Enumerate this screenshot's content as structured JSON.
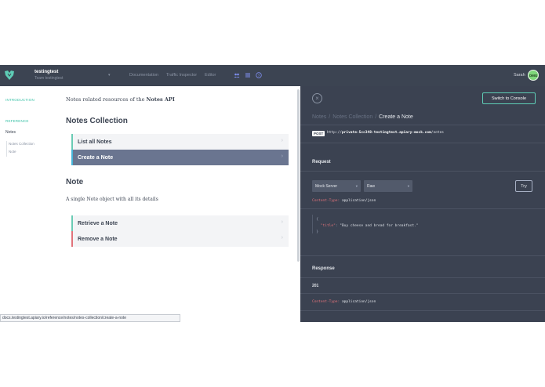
{
  "header": {
    "project_name": "testingtest",
    "project_owner": "Team testingtest",
    "nav": [
      "Documentation",
      "Traffic Inspector",
      "Editor"
    ],
    "user": "Sarah",
    "avatar_initials": "OMG"
  },
  "sidebar": {
    "introduction": "INTRODUCTION",
    "reference": "REFERENCE",
    "group": "Notes",
    "items": [
      "Notes Collection",
      "Note"
    ]
  },
  "main": {
    "intro_prefix": "Notes related resources of the ",
    "intro_api": "Notes API",
    "collection_title": "Notes Collection",
    "collection_actions": [
      "List all Notes",
      "Create a Note"
    ],
    "note_title": "Note",
    "note_desc": "A single Note object with all its details",
    "note_actions": [
      "Retrieve a Note",
      "Remove a Note"
    ],
    "chevron": "›"
  },
  "console": {
    "close": "×",
    "switch_label": "Switch to Console",
    "breadcrumbs": [
      "Notes",
      "Notes Collection",
      "Create a Note"
    ],
    "breadcrumb_sep": "/",
    "method": "POST",
    "url_prefix": "http://",
    "url_host": "private-5cc348-testingtest.apiary-mock.com",
    "url_path": "/notes",
    "request_title": "Request",
    "server_select": "Mock Server",
    "format_select": "Raw",
    "try_label": "Try",
    "request_header_key": "Content-Type:",
    "request_header_value": " application/json",
    "body_open": "{",
    "body_key": "\"title\"",
    "body_colon": ": ",
    "body_value": "\"Buy cheese and bread for breakfast.\"",
    "body_close": "}",
    "response_title": "Response",
    "status_code": "201",
    "response_header_key": "Content-Type:",
    "response_header_value": " application/json"
  },
  "statusbar": {
    "url": "docs.testingtest.apiary.io/reference/notes/notes-collection/create-a-note"
  },
  "colors": {
    "topbar": "#3c4452",
    "panel": "#3b4251",
    "accent": "#38c1a6",
    "active_row": "#6a7590",
    "delete_accent": "#e0727a"
  }
}
